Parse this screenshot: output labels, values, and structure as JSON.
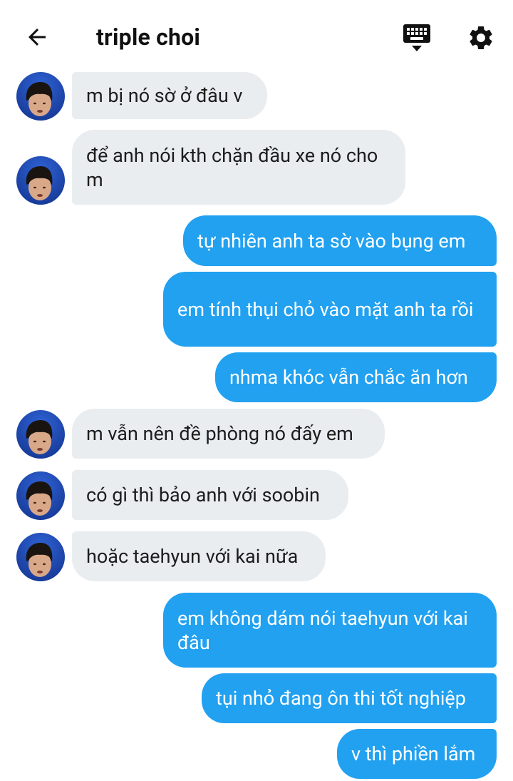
{
  "header": {
    "title": "triple choi",
    "back_icon": "arrow-left-icon",
    "keyboard_icon": "keyboard-icon",
    "settings_icon": "gear-icon"
  },
  "colors": {
    "incoming_bubble": "#e9edf0",
    "outgoing_bubble": "#21a1f0",
    "incoming_text": "#1d1d1d",
    "outgoing_text": "#ffffff"
  },
  "messages": [
    {
      "dir": "in",
      "text": "m bị nó sờ ở đâu v"
    },
    {
      "dir": "in",
      "text": "để anh nói kth chặn đầu xe nó cho m"
    },
    {
      "dir": "out",
      "text": "tự nhiên anh ta sờ vào bụng em"
    },
    {
      "dir": "out",
      "text": "em tính thụi chỏ vào mặt anh ta rồi"
    },
    {
      "dir": "out",
      "text": "nhma khóc vẫn chắc ăn hơn"
    },
    {
      "dir": "in",
      "text": "m vẫn nên đề phòng nó đấy em"
    },
    {
      "dir": "in",
      "text": "có gì thì bảo anh với soobin"
    },
    {
      "dir": "in",
      "text": "hoặc taehyun với kai nữa"
    },
    {
      "dir": "out",
      "text": "em không dám nói taehyun với kai đâu"
    },
    {
      "dir": "out",
      "text": "tụi nhỏ đang ôn thi tốt nghiệp"
    },
    {
      "dir": "out",
      "text": "v thì phiền lắm"
    }
  ]
}
